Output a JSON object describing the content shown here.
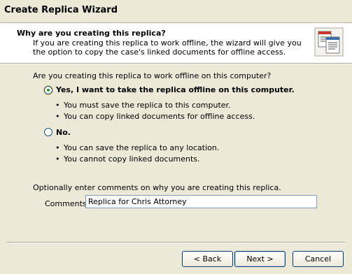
{
  "window": {
    "title": "Create Replica Wizard"
  },
  "header": {
    "title": "Why are you creating this replica?",
    "description": "If you are creating this replica to work offline, the wizard will give you the option to copy the case's linked documents for offline access.",
    "icon": "documents-icon"
  },
  "main": {
    "question": "Are you creating this replica to work offline on this computer?",
    "options": [
      {
        "label": "Yes, I want to take the replica offline on this computer.",
        "selected": true,
        "bullets": [
          "You must save the replica to this computer.",
          "You can copy linked documents for offline access."
        ]
      },
      {
        "label": "No.",
        "selected": false,
        "bullets": [
          "You can save the replica to any location.",
          "You cannot copy linked documents."
        ]
      }
    ],
    "comments_prompt": "Optionally enter comments on why you are creating this replica.",
    "comments_label": "Comments:",
    "comments_value": "Replica for Chris Attorney"
  },
  "footer": {
    "back_label": "< Back",
    "next_label": "Next >",
    "cancel_label": "Cancel"
  }
}
